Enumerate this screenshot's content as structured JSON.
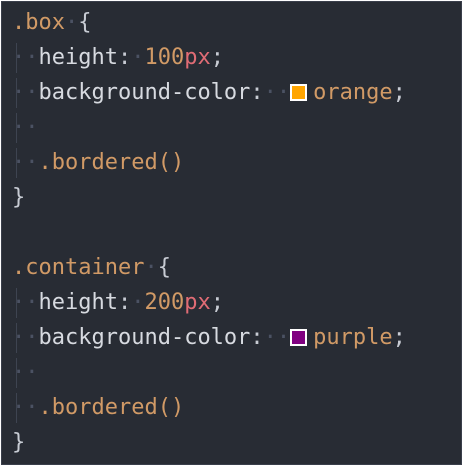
{
  "rules": [
    {
      "selector": ".box",
      "open_brace": "{",
      "close_brace": "}",
      "declarations": [
        {
          "property": "height",
          "number": "100",
          "unit": "px"
        },
        {
          "property": "background-color",
          "value": "orange",
          "swatch_color": "#ffa500"
        }
      ],
      "mixin": ".bordered()"
    },
    {
      "selector": ".container",
      "open_brace": "{",
      "close_brace": "}",
      "declarations": [
        {
          "property": "height",
          "number": "200",
          "unit": "px"
        },
        {
          "property": "background-color",
          "value": "purple",
          "swatch_color": "#800080"
        }
      ],
      "mixin": ".bordered()"
    }
  ],
  "colors": {
    "editor_background": "#282c34",
    "selector": "#d19a66",
    "number": "#d19a66",
    "unit": "#e06c75",
    "property": "#d7dae0"
  }
}
